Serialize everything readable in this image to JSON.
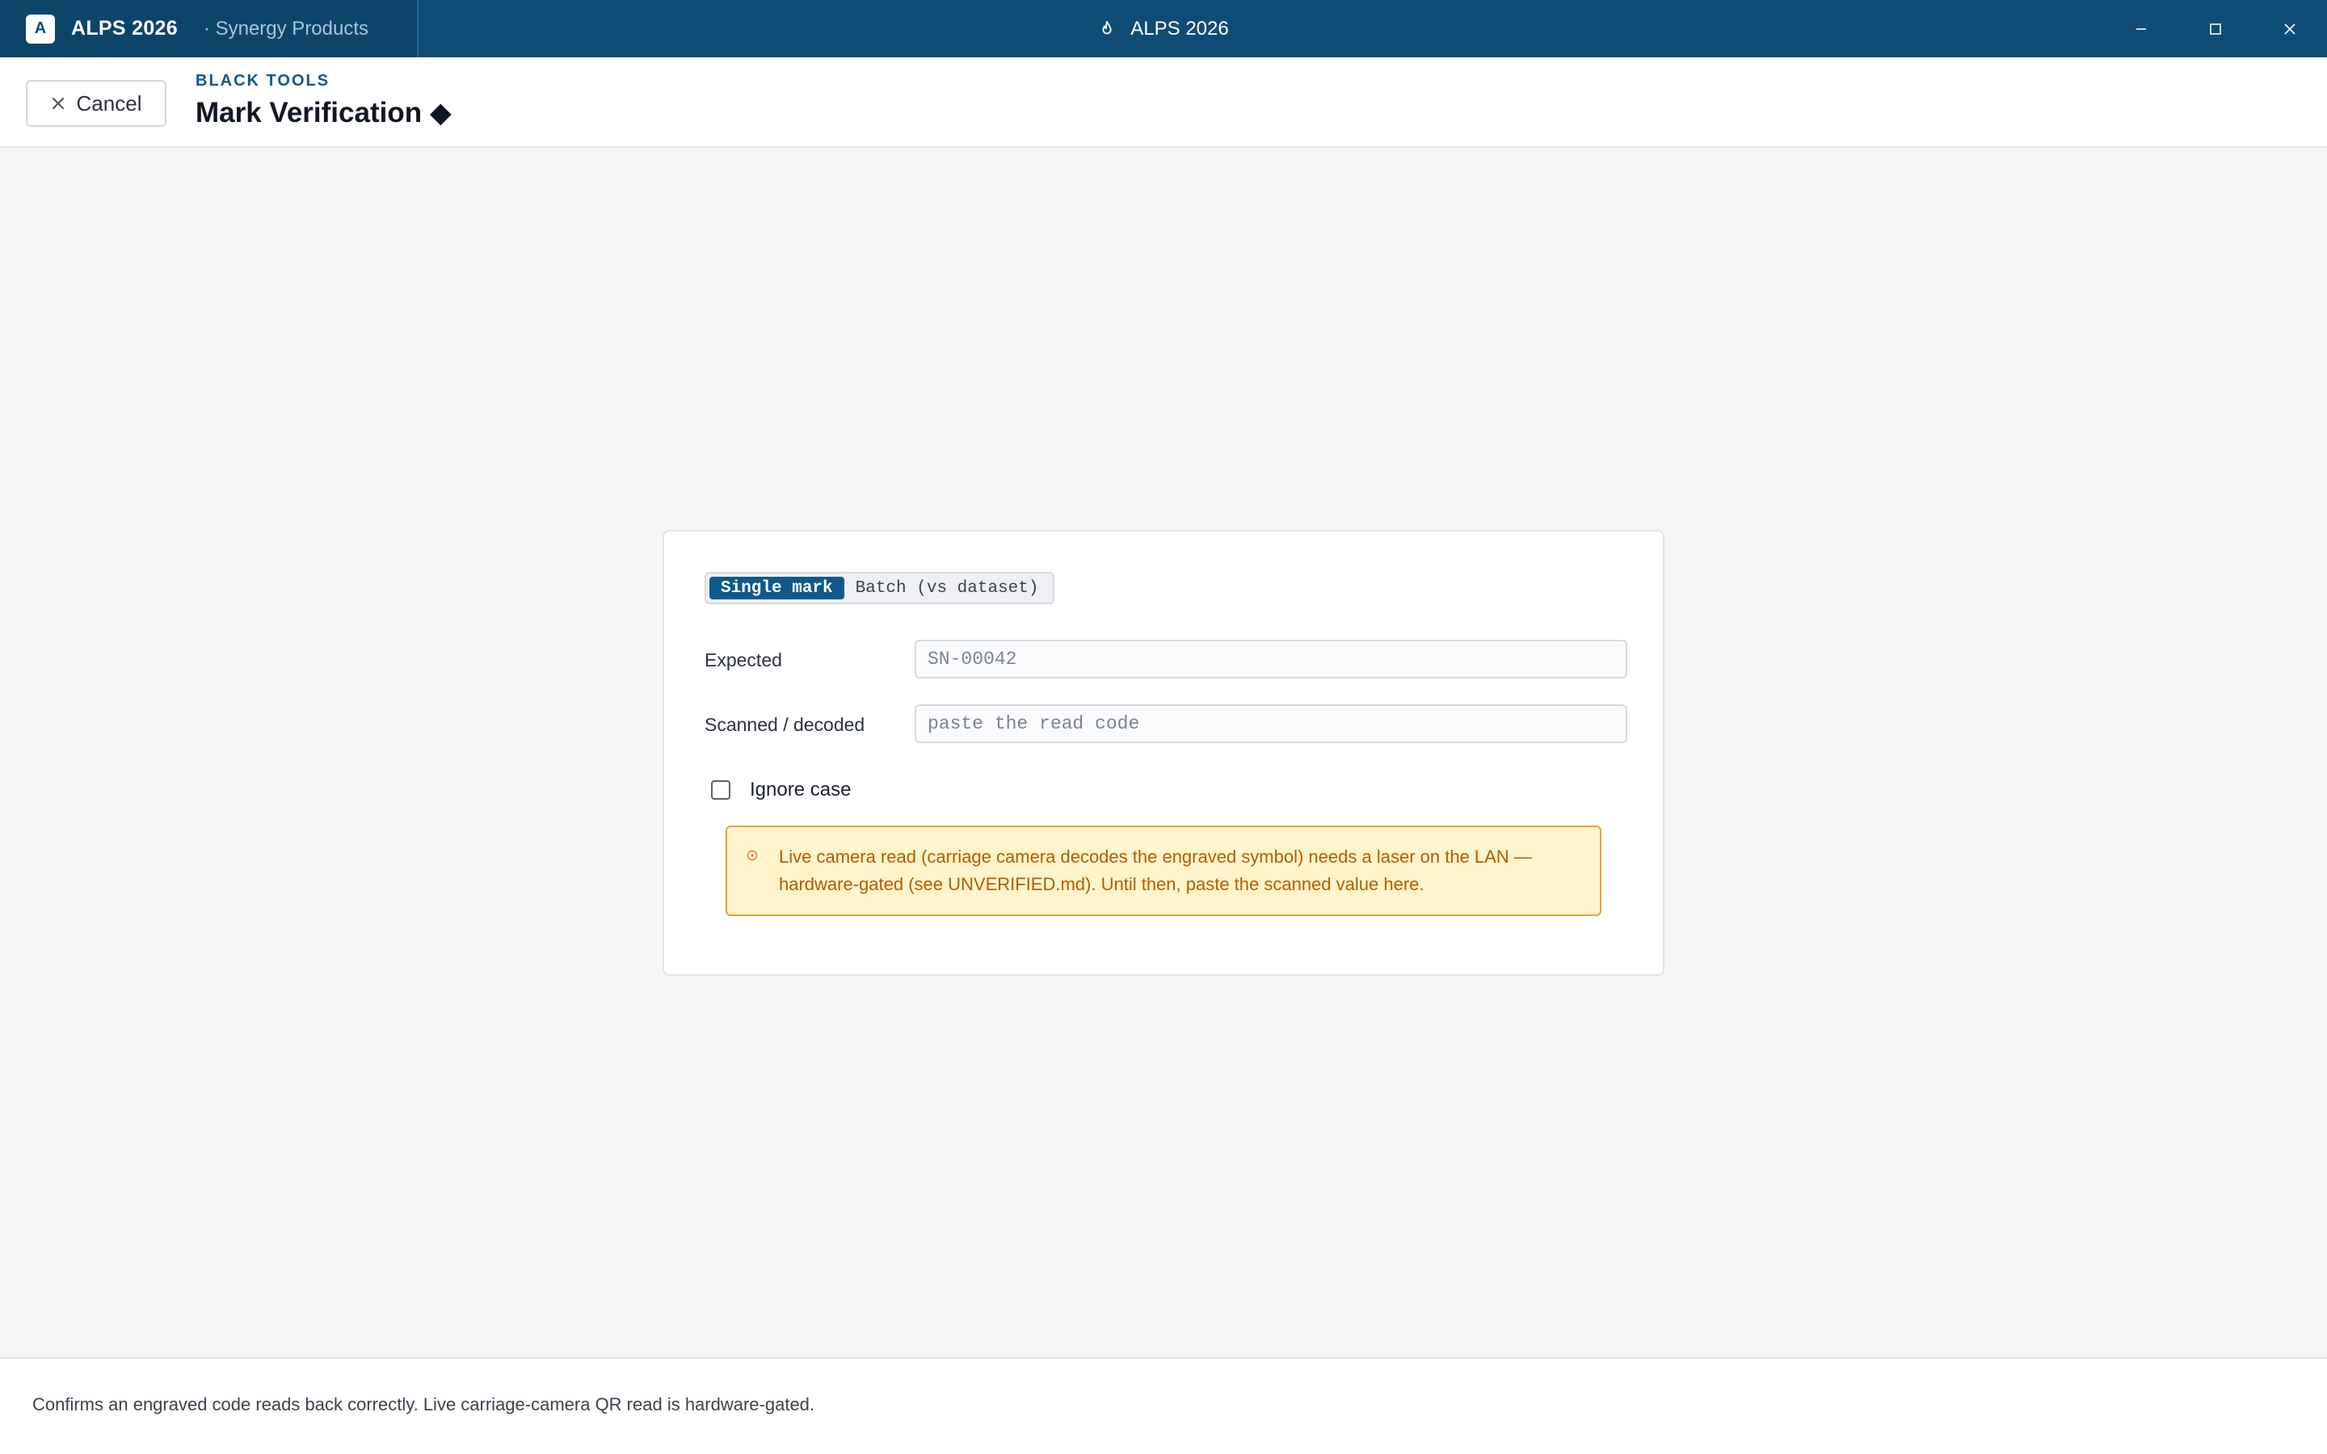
{
  "titlebar": {
    "logo_letter": "A",
    "app_name": "ALPS 2026",
    "workspace": "· Synergy Products",
    "center_title": "ALPS 2026"
  },
  "header": {
    "cancel_label": "Cancel",
    "kicker": "BLACK TOOLS",
    "title": "Mark Verification ◆"
  },
  "mode_tabs": [
    {
      "label": "Single mark",
      "active": true
    },
    {
      "label": "Batch (vs dataset)",
      "active": false
    }
  ],
  "form": {
    "expected_label": "Expected",
    "expected_placeholder": "SN-00042",
    "scanned_label": "Scanned / decoded",
    "scanned_placeholder": "paste the read code",
    "ignore_case_label": "Ignore case",
    "ignore_case_checked": false
  },
  "notice": {
    "text": "Live camera read (carriage camera decodes the engraved symbol) needs a laser on the LAN — hardware-gated (see UNVERIFIED.md). Until then, paste the scanned value here."
  },
  "footer": {
    "text": "Confirms an engraved code reads back correctly. Live carriage-camera QR read is hardware-gated."
  },
  "colors": {
    "titlebar_bg": "#0f4c75",
    "accent": "#0f5a8a",
    "notice_bg": "#fff4cc",
    "notice_border": "#e7a33a",
    "notice_text": "#b45d00",
    "page_bg": "#f5f6f8"
  },
  "icons": {
    "window_controls": [
      "minimize-icon",
      "maximize-icon",
      "close-icon"
    ],
    "title_icon": "flame-icon",
    "cancel_icon": "close-icon",
    "notice_icon": "warning-dot-icon"
  }
}
